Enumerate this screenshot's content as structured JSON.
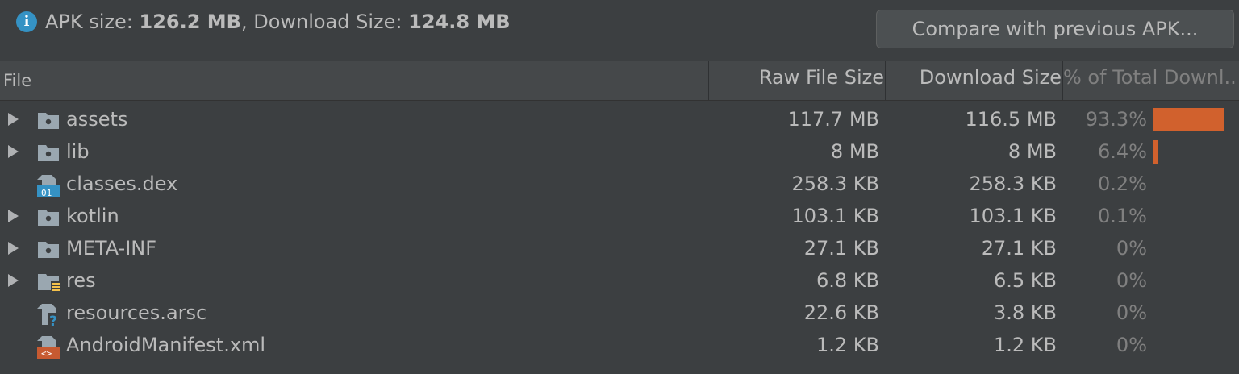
{
  "header": {
    "apk_size_label": "APK size: ",
    "apk_size_value": "126.2 MB",
    "download_size_label": ", Download Size: ",
    "download_size_value": "124.8 MB",
    "compare_button": "Compare with previous APK..."
  },
  "columns": {
    "file": "File",
    "raw": "Raw File Size",
    "download": "Download Size",
    "percent": "% of Total Downl..."
  },
  "rows": [
    {
      "name": "assets",
      "raw": "117.7 MB",
      "download": "116.5 MB",
      "percent": "93.3%",
      "share": 0.933,
      "icon": "folder-icon",
      "expandable": true
    },
    {
      "name": "lib",
      "raw": "8 MB",
      "download": "8 MB",
      "percent": "6.4%",
      "share": 0.064,
      "icon": "folder-icon",
      "expandable": true
    },
    {
      "name": "classes.dex",
      "raw": "258.3 KB",
      "download": "258.3 KB",
      "percent": "0.2%",
      "share": 0.002,
      "icon": "dex-file-icon",
      "expandable": false
    },
    {
      "name": "kotlin",
      "raw": "103.1 KB",
      "download": "103.1 KB",
      "percent": "0.1%",
      "share": 0.001,
      "icon": "folder-icon",
      "expandable": true
    },
    {
      "name": "META-INF",
      "raw": "27.1 KB",
      "download": "27.1 KB",
      "percent": "0%",
      "share": 0,
      "icon": "folder-icon",
      "expandable": true
    },
    {
      "name": "res",
      "raw": "6.8 KB",
      "download": "6.5 KB",
      "percent": "0%",
      "share": 0,
      "icon": "resource-folder-icon",
      "expandable": true
    },
    {
      "name": "resources.arsc",
      "raw": "22.6 KB",
      "download": "3.8 KB",
      "percent": "0%",
      "share": 0,
      "icon": "unknown-file-icon",
      "expandable": false
    },
    {
      "name": "AndroidManifest.xml",
      "raw": "1.2 KB",
      "download": "1.2 KB",
      "percent": "0%",
      "share": 0,
      "icon": "xml-file-icon",
      "expandable": false
    }
  ],
  "colors": {
    "bar": "#d1612d",
    "info": "#3592c4"
  }
}
